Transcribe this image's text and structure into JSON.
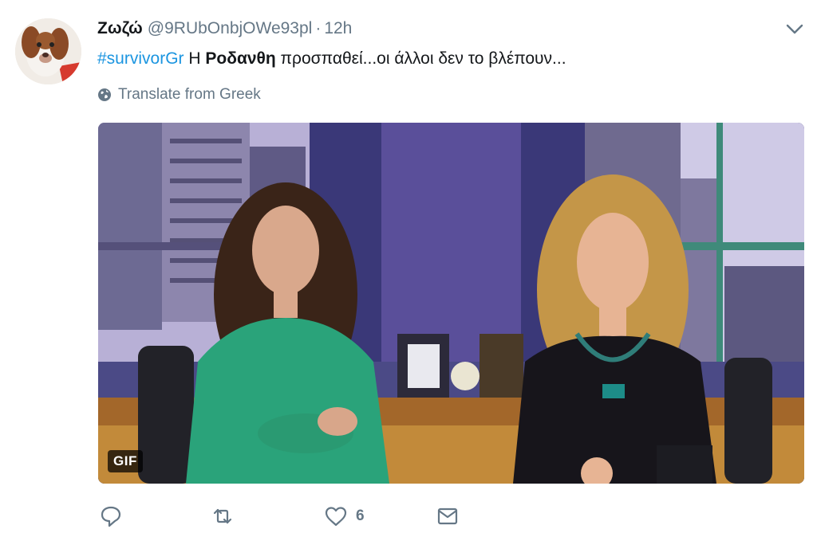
{
  "tweet": {
    "name": "Ζωζώ",
    "handle": "@9RUbOnbjOWe93pl",
    "separator": "·",
    "time": "12h",
    "text": {
      "hashtag": "#survivorGr",
      "part1": " Η ",
      "bold": "Ροδανθη",
      "part2": " προσπαθεί...οι άλλοι δεν το βλέπουν..."
    },
    "translate_label": "Translate from Greek",
    "media": {
      "badge": "GIF"
    },
    "actions": {
      "reply_icon": "reply-icon",
      "retweet_icon": "retweet-icon",
      "like_icon": "heart-icon",
      "like_count": "6",
      "dm_icon": "envelope-icon"
    }
  },
  "colors": {
    "hashtag": "#1b95e0",
    "secondary_text": "#657786",
    "primary_text": "#14171a"
  }
}
